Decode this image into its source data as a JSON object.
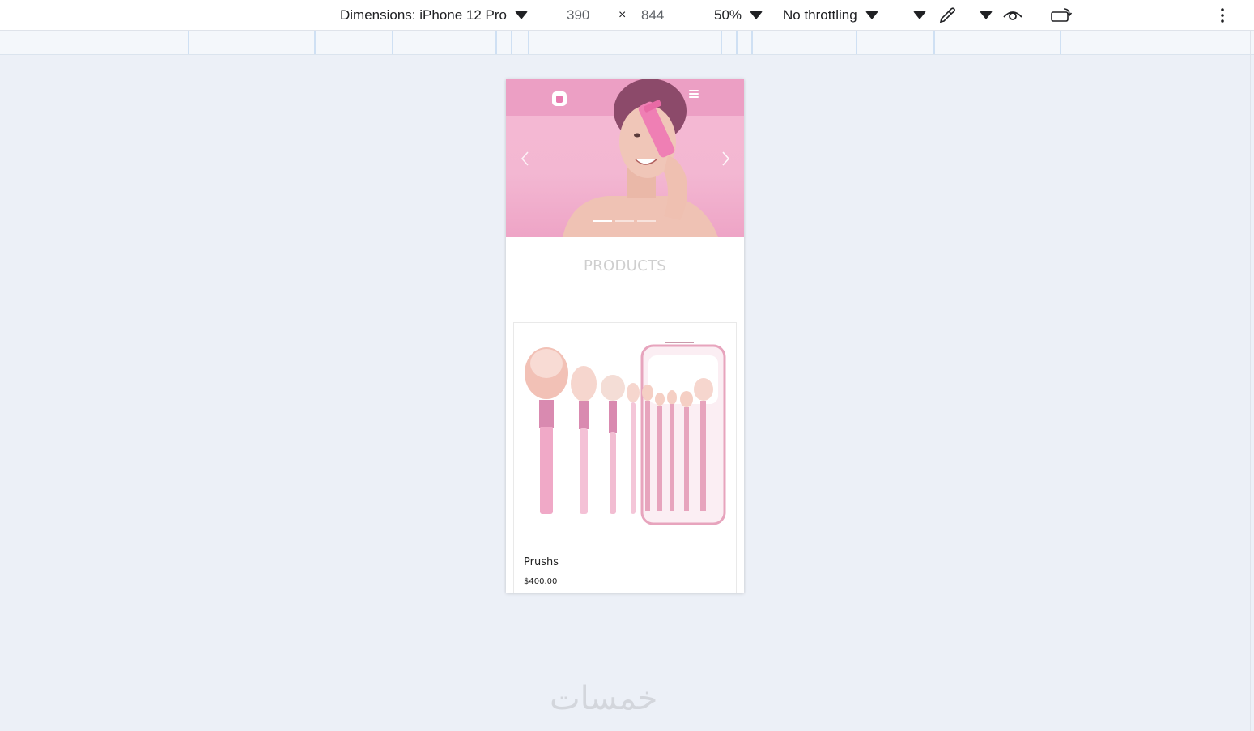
{
  "toolbar": {
    "dimensions_label": "Dimensions: iPhone 12 Pro",
    "width": "390",
    "times": "×",
    "height": "844",
    "zoom": "50%",
    "throttling": "No throttling"
  },
  "page": {
    "products_heading": "PRODUCTS",
    "product": {
      "name": "Prushs",
      "price": "$400.00"
    },
    "carousel": {
      "slide_count": 3,
      "active_slide": 1
    }
  },
  "watermark": {
    "text": "خمسات"
  },
  "colors": {
    "hero_pink": "#f3b7d2",
    "accent_pink": "#e87bb0",
    "page_bg": "#ecf0f7"
  }
}
